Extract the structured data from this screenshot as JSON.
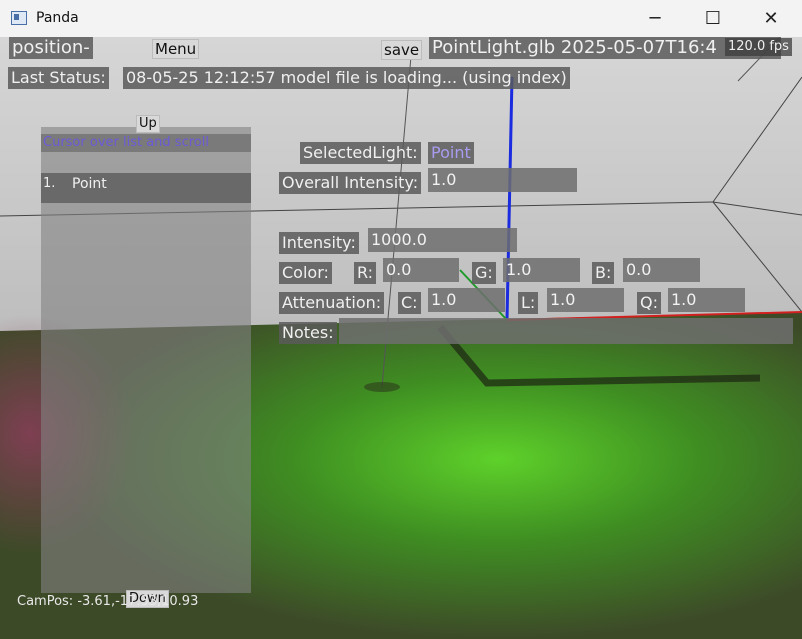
{
  "window": {
    "title": "Panda",
    "minimize_glyph": "─",
    "maximize_glyph": "☐",
    "close_glyph": "✕"
  },
  "topbar": {
    "position_label": "position-",
    "menu_button": "Menu",
    "save_button": "save",
    "filename": "PointLight.glb 2025-05-07T16:4",
    "fps": "120.0 fps"
  },
  "status": {
    "label": "Last Status:",
    "message": "08-05-25 12:12:57 model file is loading... (using index)"
  },
  "light_list": {
    "up_button": "Up",
    "header": "Cursor over list and scroll",
    "items": [
      {
        "index": "1.",
        "name": "Point"
      }
    ],
    "down_button": "Down"
  },
  "properties": {
    "selected_light_label": "SelectedLight:",
    "selected_light_value": "Point",
    "overall_intensity_label": "Overall Intensity:",
    "overall_intensity_value": "1.0",
    "intensity_label": "Intensity:",
    "intensity_value": "1000.0",
    "color_label": "Color:",
    "r_label": "R:",
    "r_value": "0.0",
    "g_label": "G:",
    "g_value": "1.0",
    "b_label": "B:",
    "b_value": "0.0",
    "attenuation_label": "Attenuation:",
    "c_label": "C:",
    "c_value": "1.0",
    "l_label": "L:",
    "l_value": "1.0",
    "q_label": "Q:",
    "q_value": "1.0",
    "notes_label": "Notes:",
    "notes_value": ""
  },
  "campos": "CamPos: -3.61,-17.33,10.93",
  "colors": {
    "selected_value": "#a89cf0",
    "list_header": "#6b5bd8",
    "axis_blue": "#1a2be0",
    "axis_red": "#d22020",
    "axis_green": "#1f9a2a"
  }
}
